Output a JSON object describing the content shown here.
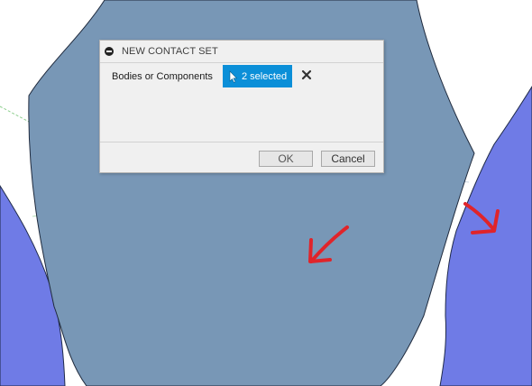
{
  "dialog": {
    "title": "NEW CONTACT SET",
    "field_label": "Bodies or Components",
    "selection_text": "2 selected",
    "ok_label": "OK",
    "cancel_label": "Cancel"
  },
  "icons": {
    "collapse": "minus-circle-icon",
    "cursor": "cursor-arrow-icon",
    "clear": "close-x-icon"
  },
  "colors": {
    "center_gear": "#7897b6",
    "side_gears": "#6f7be6",
    "annotation_arrows": "#e0242a",
    "selection_chip": "#0b8fd8"
  }
}
